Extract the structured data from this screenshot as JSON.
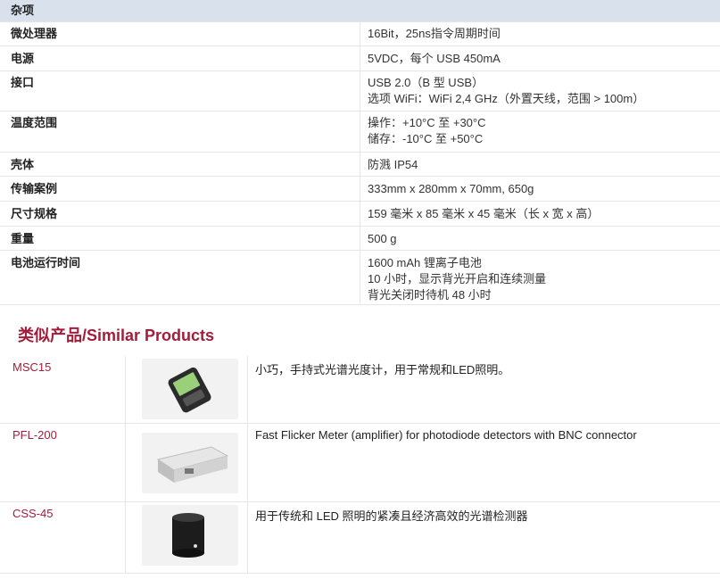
{
  "specs": {
    "section_header": "杂项",
    "rows": [
      {
        "label": "微处理器",
        "lines": [
          "16Bit，25ns指令周期时间"
        ]
      },
      {
        "label": "电源",
        "lines": [
          "5VDC，每个 USB 450mA"
        ]
      },
      {
        "label": "接口",
        "lines": [
          "USB 2.0（B 型 USB）",
          "选项 WiFi：WiFi 2,4 GHz（外置天线，范围 > 100m）"
        ]
      },
      {
        "label": "温度范围",
        "lines": [
          "操作：+10°C 至 +30°C",
          "储存：-10°C 至 +50°C"
        ]
      },
      {
        "label": "壳体",
        "lines": [
          "防溅 IP54"
        ]
      },
      {
        "label": "传输案例",
        "lines": [
          "333mm x 280mm x 70mm, 650g"
        ]
      },
      {
        "label": "尺寸规格",
        "lines": [
          "159 毫米 x 85 毫米 x 45 毫米（长 x 宽 x 高）"
        ]
      },
      {
        "label": "重量",
        "lines": [
          "500 g"
        ]
      },
      {
        "label": "电池运行时间",
        "lines": [
          "1600 mAh 锂离子电池",
          "10 小时，显示背光开启和连续测量",
          "背光关闭时待机 48 小时"
        ]
      }
    ]
  },
  "similar": {
    "title": "类似产品/Similar Products",
    "products": [
      {
        "code": "MSC15",
        "description": "小巧，手持式光谱光度计，用于常规和LED照明。",
        "image_icon": "handheld-meter-icon"
      },
      {
        "code": "PFL-200",
        "description": "Fast Flicker Meter (amplifier) for photodiode detectors with BNC connector",
        "image_icon": "flicker-amplifier-box-icon"
      },
      {
        "code": "CSS-45",
        "description": "用于传统和 LED 照明的紧凑且经济高效的光谱检测器",
        "image_icon": "cylindrical-detector-icon"
      }
    ]
  },
  "colors": {
    "accent": "#a31d3a",
    "header_bg": "#d9e1ec",
    "border": "#e6e6e6"
  }
}
